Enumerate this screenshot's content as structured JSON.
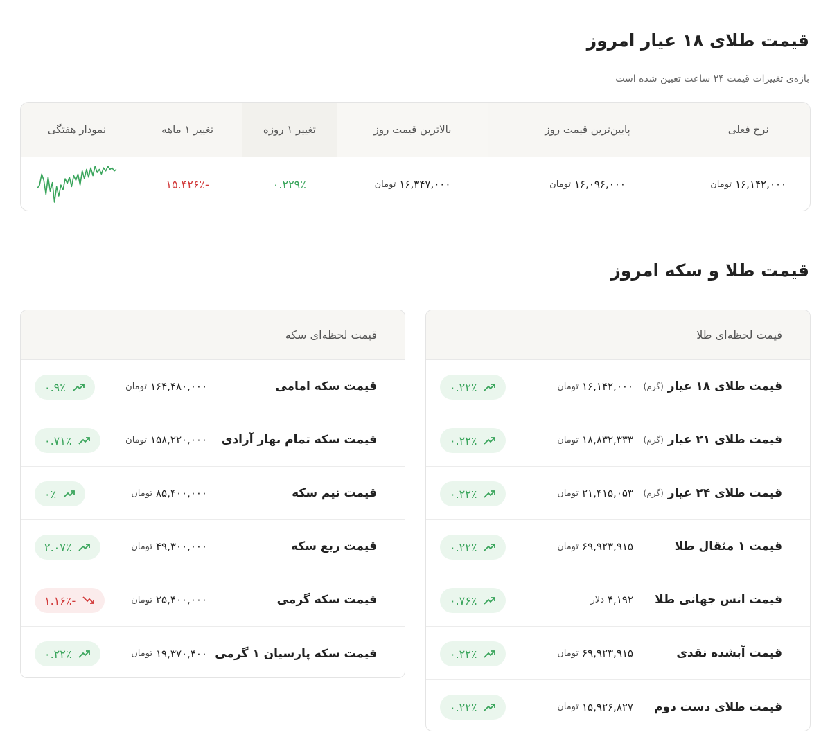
{
  "title18": "قیمت طلای ۱۸ عیار امروز",
  "subtitle": "بازه‌ی تغییرات قیمت ۲۴ ساعت تعیین شده است",
  "summary": {
    "headers": [
      "نرخ فعلی",
      "پایین‌ترین قیمت روز",
      "بالاترین قیمت روز",
      "تغییر ۱ روزه",
      "تغییر ۱ ماهه",
      "نمودار هفتگی"
    ],
    "current": "۱۶,۱۴۲,۰۰۰",
    "low": "۱۶,۰۹۶,۰۰۰",
    "high": "۱۶,۳۴۷,۰۰۰",
    "currency": "تومان",
    "change_day": "۰.۲۲۹٪",
    "change_month": "-۱۵.۴۲۶٪",
    "spark_color": "#3aa55c",
    "spark": [
      62,
      58,
      44,
      52,
      70,
      48,
      66,
      55,
      80,
      60,
      72,
      58,
      64,
      50,
      56,
      48,
      60,
      46,
      52,
      44,
      58,
      40,
      50,
      38,
      48,
      36,
      46,
      34,
      42,
      38,
      44,
      36,
      40,
      34,
      38,
      36,
      40,
      38
    ]
  },
  "title_all": "قیمت طلا و سکه امروز",
  "gold_card": {
    "title": "قیمت لحظه‌ای طلا",
    "rows": [
      {
        "name": "قیمت طلای ۱۸ عیار",
        "unit": "(گرم)",
        "price": "۱۶,۱۴۲,۰۰۰",
        "currency": "تومان",
        "change": "۰.۲۲٪",
        "dir": "up"
      },
      {
        "name": "قیمت طلای ۲۱ عیار",
        "unit": "(گرم)",
        "price": "۱۸,۸۳۲,۳۳۳",
        "currency": "تومان",
        "change": "۰.۲۲٪",
        "dir": "up"
      },
      {
        "name": "قیمت طلای ۲۴ عیار",
        "unit": "(گرم)",
        "price": "۲۱,۴۱۵,۰۵۳",
        "currency": "تومان",
        "change": "۰.۲۲٪",
        "dir": "up"
      },
      {
        "name": "قیمت ۱ مثقال طلا",
        "unit": "",
        "price": "۶۹,۹۲۳,۹۱۵",
        "currency": "تومان",
        "change": "۰.۲۲٪",
        "dir": "up"
      },
      {
        "name": "قیمت انس جهانی طلا",
        "unit": "",
        "price": "۴,۱۹۲",
        "currency": "دلار",
        "change": "۰.۷۶٪",
        "dir": "up"
      },
      {
        "name": "قیمت آبشده نقدی",
        "unit": "",
        "price": "۶۹,۹۲۳,۹۱۵",
        "currency": "تومان",
        "change": "۰.۲۲٪",
        "dir": "up"
      },
      {
        "name": "قیمت طلای دست دوم",
        "unit": "",
        "price": "۱۵,۹۲۶,۸۲۷",
        "currency": "تومان",
        "change": "۰.۲۲٪",
        "dir": "up"
      }
    ]
  },
  "coin_card": {
    "title": "قیمت لحظه‌ای سکه",
    "rows": [
      {
        "name": "قیمت سکه امامی",
        "unit": "",
        "price": "۱۶۴,۴۸۰,۰۰۰",
        "currency": "تومان",
        "change": "۰.۹٪",
        "dir": "up"
      },
      {
        "name": "قیمت سکه تمام بهار آزادی",
        "unit": "",
        "price": "۱۵۸,۲۲۰,۰۰۰",
        "currency": "تومان",
        "change": "۰.۷۱٪",
        "dir": "up"
      },
      {
        "name": "قیمت نیم سکه",
        "unit": "",
        "price": "۸۵,۴۰۰,۰۰۰",
        "currency": "تومان",
        "change": "۰٪",
        "dir": "up"
      },
      {
        "name": "قیمت ربع سکه",
        "unit": "",
        "price": "۴۹,۳۰۰,۰۰۰",
        "currency": "تومان",
        "change": "۲.۰۷٪",
        "dir": "up"
      },
      {
        "name": "قیمت سکه گرمی",
        "unit": "",
        "price": "۲۵,۴۰۰,۰۰۰",
        "currency": "تومان",
        "change": "-۱.۱۶٪",
        "dir": "down"
      },
      {
        "name": "قیمت سکه پارسیان ۱ گرمی",
        "unit": "",
        "price": "۱۹,۳۷۰,۴۰۰",
        "currency": "تومان",
        "change": "۰.۲۲٪",
        "dir": "up"
      }
    ]
  }
}
